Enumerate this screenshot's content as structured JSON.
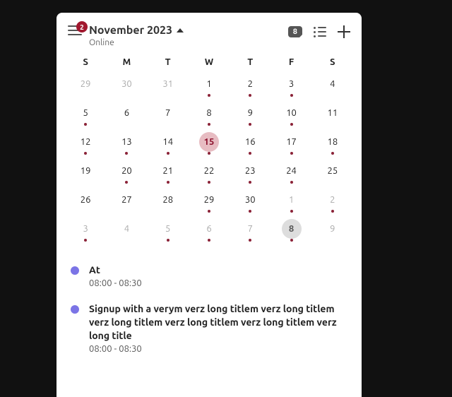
{
  "header": {
    "notification_count": "2",
    "title": "November 2023",
    "subtitle": "Online",
    "today_chip": "8"
  },
  "weekdays": [
    "S",
    "M",
    "T",
    "W",
    "T",
    "F",
    "S"
  ],
  "weeks": [
    [
      {
        "n": "29",
        "other": true
      },
      {
        "n": "30",
        "other": true
      },
      {
        "n": "31",
        "other": true
      },
      {
        "n": "1",
        "dot": true
      },
      {
        "n": "2",
        "dot": true
      },
      {
        "n": "3",
        "dot": true
      },
      {
        "n": "4"
      }
    ],
    [
      {
        "n": "5",
        "dot": true
      },
      {
        "n": "6"
      },
      {
        "n": "7"
      },
      {
        "n": "8",
        "dot": true
      },
      {
        "n": "9",
        "dot": true
      },
      {
        "n": "10",
        "dot": true
      },
      {
        "n": "11"
      }
    ],
    [
      {
        "n": "12",
        "dot": true
      },
      {
        "n": "13",
        "dot": true
      },
      {
        "n": "14",
        "dot": true
      },
      {
        "n": "15",
        "dot": true,
        "selected": true
      },
      {
        "n": "16",
        "dot": true
      },
      {
        "n": "17",
        "dot": true
      },
      {
        "n": "18",
        "dot": true
      }
    ],
    [
      {
        "n": "19"
      },
      {
        "n": "20",
        "dot": true
      },
      {
        "n": "21",
        "dot": true
      },
      {
        "n": "22",
        "dot": true
      },
      {
        "n": "23",
        "dot": true
      },
      {
        "n": "24",
        "dot": true
      },
      {
        "n": "25"
      }
    ],
    [
      {
        "n": "26"
      },
      {
        "n": "27"
      },
      {
        "n": "28"
      },
      {
        "n": "29",
        "dot": true
      },
      {
        "n": "30",
        "dot": true
      },
      {
        "n": "1",
        "other": true,
        "dot": true
      },
      {
        "n": "2",
        "other": true,
        "dot": true
      }
    ],
    [
      {
        "n": "3",
        "other": true,
        "dot": true
      },
      {
        "n": "4",
        "other": true
      },
      {
        "n": "5",
        "other": true,
        "dot": true
      },
      {
        "n": "6",
        "other": true,
        "dot": true
      },
      {
        "n": "7",
        "other": true,
        "dot": true
      },
      {
        "n": "8",
        "other": true,
        "today": true,
        "dot": true
      },
      {
        "n": "9",
        "other": true
      }
    ]
  ],
  "events": [
    {
      "title": "At",
      "time": "08:00 - 08:30",
      "color": "#7b74e6"
    },
    {
      "title": "Signup with a verym verz long titlem verz long titlem verz long titlem verz long titlem verz long titlem verz long title",
      "time": "08:00 - 08:30",
      "color": "#7b74e6"
    }
  ]
}
